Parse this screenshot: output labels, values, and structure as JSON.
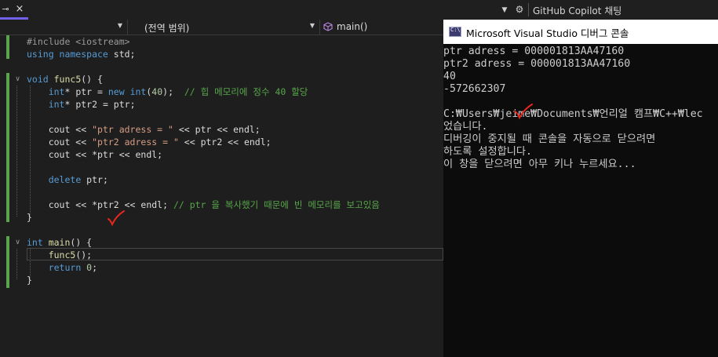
{
  "topbar": {
    "pin_glyph": "⊸",
    "close_glyph": "×",
    "dropdown_glyph": "▼",
    "gear_glyph": "⚙",
    "copilot_label": "GitHub Copilot 채팅",
    "accent_color": "#7160e8"
  },
  "navbar": {
    "project_dropdown": "",
    "scope_dropdown": "(전역 범위)",
    "member_dropdown": "main()",
    "arrow_glyph": "▼"
  },
  "editor": {
    "fold_glyph": "∨",
    "lines": [
      [
        [
          "inc",
          "#include <iostream>"
        ]
      ],
      [
        [
          "kw",
          "using namespace "
        ],
        [
          "plain",
          "std;"
        ]
      ],
      [],
      [
        [
          "kw",
          "void "
        ],
        [
          "fn",
          "func5"
        ],
        [
          "plain",
          "() {"
        ]
      ],
      [
        [
          "plain",
          "    "
        ],
        [
          "kw",
          "int"
        ],
        [
          "plain",
          "* ptr = "
        ],
        [
          "kw",
          "new int"
        ],
        [
          "plain",
          "("
        ],
        [
          "num",
          "40"
        ],
        [
          "plain",
          ");  "
        ],
        [
          "cm",
          "// 힙 메모리에 정수 40 할당"
        ]
      ],
      [
        [
          "plain",
          "    "
        ],
        [
          "kw",
          "int"
        ],
        [
          "plain",
          "* ptr2 = ptr;"
        ]
      ],
      [],
      [
        [
          "plain",
          "    cout << "
        ],
        [
          "str",
          "\"ptr adress = \""
        ],
        [
          "plain",
          " << ptr << endl;"
        ]
      ],
      [
        [
          "plain",
          "    cout << "
        ],
        [
          "str",
          "\"ptr2 adress = \""
        ],
        [
          "plain",
          " << ptr2 << endl;"
        ]
      ],
      [
        [
          "plain",
          "    cout << *ptr << endl;"
        ]
      ],
      [],
      [
        [
          "plain",
          "    "
        ],
        [
          "kw",
          "delete "
        ],
        [
          "plain",
          "ptr;"
        ]
      ],
      [],
      [
        [
          "plain",
          "    cout << *ptr2 << endl; "
        ],
        [
          "cm",
          "// ptr 을 복사했기 때문에 빈 메모리를 보고있음"
        ]
      ],
      [
        [
          "plain",
          "}"
        ]
      ],
      [],
      [
        [
          "kw",
          "int "
        ],
        [
          "fn",
          "main"
        ],
        [
          "plain",
          "() {"
        ]
      ],
      [
        [
          "plain",
          "    "
        ],
        [
          "fn",
          "func5"
        ],
        [
          "plain",
          "();"
        ]
      ],
      [
        [
          "plain",
          "    "
        ],
        [
          "kw",
          "return "
        ],
        [
          "num",
          "0"
        ],
        [
          "plain",
          ";"
        ]
      ],
      [
        [
          "plain",
          "}"
        ]
      ]
    ]
  },
  "console": {
    "title": "Microsoft Visual Studio 디버그 콘솔",
    "lines": [
      "ptr adress = 000001813AA47160",
      "ptr2 adress = 000001813AA47160",
      "40",
      "-572662307",
      "",
      "C:₩Users₩jeime₩Documents₩언리얼 캠프₩C++₩lec",
      "었습니다.",
      "디버깅이 중지될 때 콘솔을 자동으로 닫으려면",
      "하도록 설정합니다.",
      "이 창을 닫으려면 아무 키나 누르세요..."
    ]
  },
  "annotations": {
    "check_color": "#e8261e"
  }
}
